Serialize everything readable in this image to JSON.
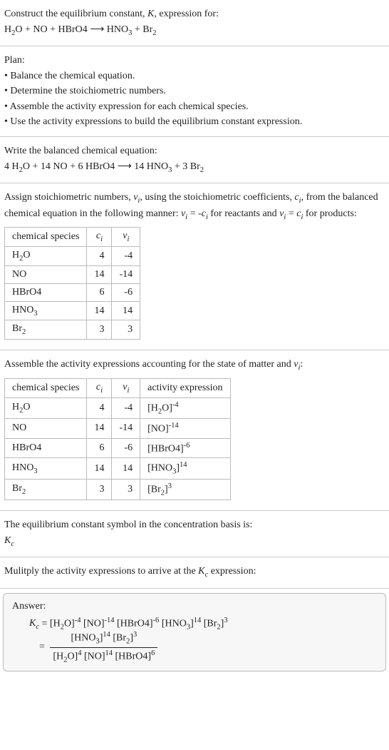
{
  "s1": {
    "l1": "Construct the equilibrium constant, K, expression for:",
    "l2": "H₂O + NO + HBrO4 ⟶ HNO₃ + Br₂"
  },
  "s2": {
    "l1": "Plan:",
    "l2": "• Balance the chemical equation.",
    "l3": "• Determine the stoichiometric numbers.",
    "l4": "• Assemble the activity expression for each chemical species.",
    "l5": "• Use the activity expressions to build the equilibrium constant expression."
  },
  "s3": {
    "l1": "Write the balanced chemical equation:",
    "l2": "4 H₂O + 14 NO + 6 HBrO4 ⟶ 14 HNO₃ + 3 Br₂"
  },
  "s4": {
    "l1": "Assign stoichiometric numbers, νᵢ, using the stoichiometric coefficients, cᵢ, from the balanced chemical equation in the following manner: νᵢ = -cᵢ for reactants and νᵢ = cᵢ for products:",
    "table": {
      "h1": "chemical species",
      "h2": "cᵢ",
      "h3": "νᵢ",
      "rows": [
        {
          "sp": "H₂O",
          "c": "4",
          "v": "-4"
        },
        {
          "sp": "NO",
          "c": "14",
          "v": "-14"
        },
        {
          "sp": "HBrO4",
          "c": "6",
          "v": "-6"
        },
        {
          "sp": "HNO₃",
          "c": "14",
          "v": "14"
        },
        {
          "sp": "Br₂",
          "c": "3",
          "v": "3"
        }
      ]
    }
  },
  "s5": {
    "l1": "Assemble the activity expressions accounting for the state of matter and νᵢ:",
    "table": {
      "h1": "chemical species",
      "h2": "cᵢ",
      "h3": "νᵢ",
      "h4": "activity expression",
      "rows": [
        {
          "sp": "H₂O",
          "c": "4",
          "v": "-4",
          "a": "[H₂O]⁻⁴"
        },
        {
          "sp": "NO",
          "c": "14",
          "v": "-14",
          "a": "[NO]⁻¹⁴"
        },
        {
          "sp": "HBrO4",
          "c": "6",
          "v": "-6",
          "a": "[HBrO4]⁻⁶"
        },
        {
          "sp": "HNO₃",
          "c": "14",
          "v": "14",
          "a": "[HNO₃]¹⁴"
        },
        {
          "sp": "Br₂",
          "c": "3",
          "v": "3",
          "a": "[Br₂]³"
        }
      ]
    }
  },
  "s6": {
    "l1": "The equilibrium constant symbol in the concentration basis is:",
    "l2": "K_c"
  },
  "s7": {
    "l1": "Mulitply the activity expressions to arrive at the K_c expression:"
  },
  "s8": {
    "label": "Answer:",
    "eq_line1_lhs": "K_c = ",
    "eq_line1_rhs": "[H₂O]⁻⁴ [NO]⁻¹⁴ [HBrO4]⁻⁶ [HNO₃]¹⁴ [Br₂]³",
    "eq_line2_lhs": "= ",
    "frac_num": "[HNO₃]¹⁴ [Br₂]³",
    "frac_den": "[H₂O]⁴ [NO]¹⁴ [HBrO4]⁶"
  },
  "chart_data": {
    "type": "table",
    "tables": [
      {
        "title": "stoichiometric numbers",
        "columns": [
          "chemical species",
          "c_i",
          "ν_i"
        ],
        "rows": [
          [
            "H2O",
            4,
            -4
          ],
          [
            "NO",
            14,
            -14
          ],
          [
            "HBrO4",
            6,
            -6
          ],
          [
            "HNO3",
            14,
            14
          ],
          [
            "Br2",
            3,
            3
          ]
        ]
      },
      {
        "title": "activity expressions",
        "columns": [
          "chemical species",
          "c_i",
          "ν_i",
          "activity expression"
        ],
        "rows": [
          [
            "H2O",
            4,
            -4,
            "[H2O]^-4"
          ],
          [
            "NO",
            14,
            -14,
            "[NO]^-14"
          ],
          [
            "HBrO4",
            6,
            -6,
            "[HBrO4]^-6"
          ],
          [
            "HNO3",
            14,
            14,
            "[HNO3]^14"
          ],
          [
            "Br2",
            3,
            3,
            "[Br2]^3"
          ]
        ]
      }
    ]
  }
}
